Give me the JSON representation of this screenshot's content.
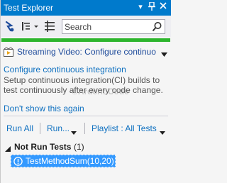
{
  "window": {
    "title": "Test Explorer"
  },
  "toolbar": {
    "search_placeholder": "Search",
    "icons": [
      "connect-icon",
      "group-by-icon",
      "dropdown-icon",
      "filter-icon",
      "search-icon"
    ]
  },
  "status": {
    "color": "#2db52d"
  },
  "video": {
    "text": "Streaming Video: Configure continuo"
  },
  "ci": {
    "heading": "Configure continuous integration",
    "description": "Setup continuous integration(CI) builds to test continuously after every code change.",
    "dont_show": "Don't show this again"
  },
  "watermark": "©Ardent Code",
  "actions": {
    "run_all": "Run All",
    "run": "Run...",
    "playlist": "Playlist : All Tests"
  },
  "tree": {
    "group_name": "Not Run Tests",
    "group_count": "(1)",
    "tests": [
      {
        "name": "TestMethodSum(10,20)"
      }
    ]
  },
  "colors": {
    "accent": "#007acc",
    "link": "#0e70c0",
    "selection": "#3399ff"
  }
}
